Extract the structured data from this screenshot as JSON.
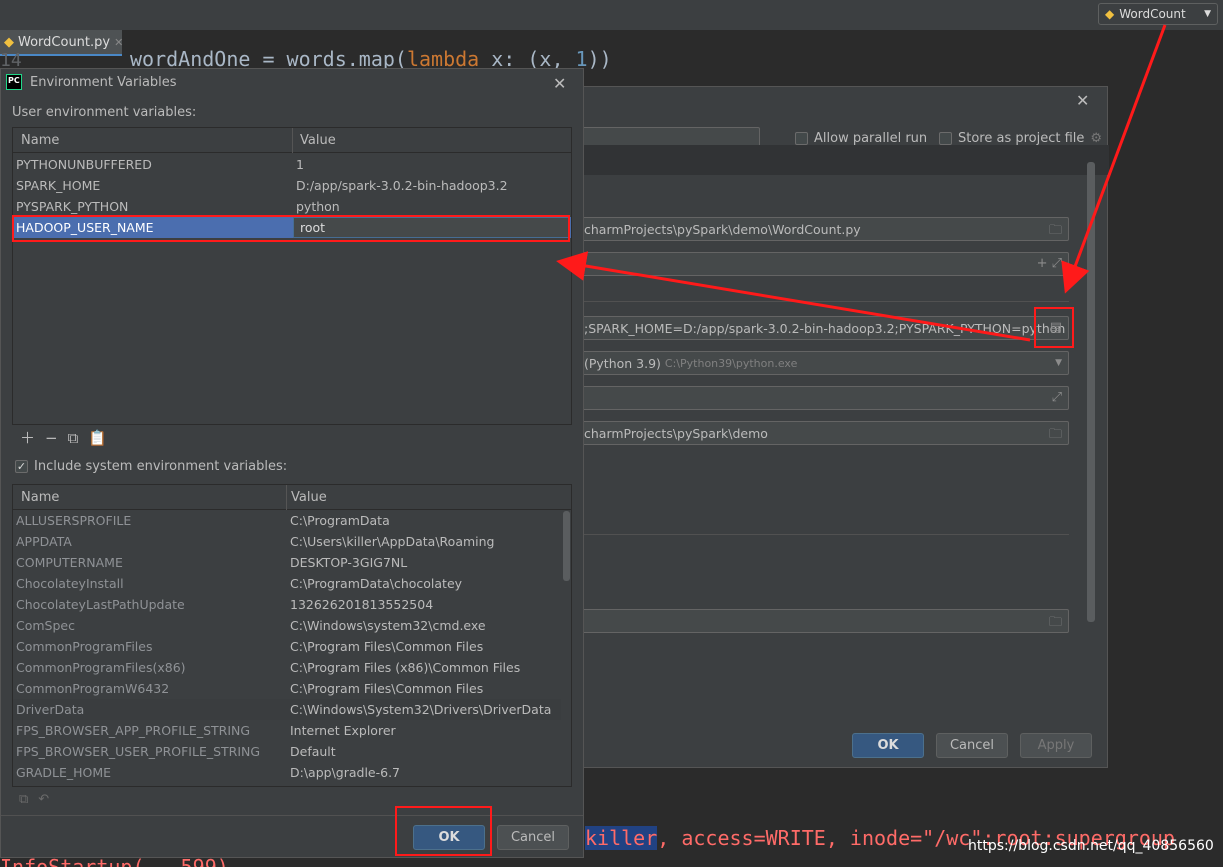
{
  "topbar": {
    "run_config_label": "WordCount"
  },
  "editor": {
    "tab_label": "WordCount.py",
    "gutter_number": "14",
    "code_prefix": "wordAndOne = words.map(",
    "code_keyword": "lambda",
    "code_mid": " x: (x, ",
    "code_num": "1",
    "code_suffix": "))",
    "console_hl": "killer",
    "console_rest": ", access=WRITE, inode=\"/wc\":root:supergroup",
    "console_line2": "InfoStartup(...599)",
    "watermark": "https://blog.csdn.net/qq_40856560"
  },
  "run_dialog": {
    "allow_parallel_label": "Allow parallel run",
    "store_project_label": "Store as project file",
    "script_path": "charmProjects\\pySpark\\demo\\WordCount.py",
    "env_vars": ";SPARK_HOME=D:/app/spark-3.0.2-bin-hadoop3.2;PYSPARK_PYTHON=python",
    "interpreter": "(Python 3.9)",
    "interpreter_path": "C:\\Python39\\python.exe",
    "working_dir": "charmProjects\\pySpark\\demo",
    "ok_label": "OK",
    "cancel_label": "Cancel",
    "apply_label": "Apply"
  },
  "env_dialog": {
    "title": "Environment Variables",
    "user_label": "User environment variables:",
    "col_name": "Name",
    "col_value": "Value",
    "user_rows": [
      {
        "name": "PYTHONUNBUFFERED",
        "value": "1"
      },
      {
        "name": "SPARK_HOME",
        "value": "D:/app/spark-3.0.2-bin-hadoop3.2"
      },
      {
        "name": "PYSPARK_PYTHON",
        "value": "python"
      },
      {
        "name": "HADOOP_USER_NAME",
        "value": "root"
      }
    ],
    "include_system_label": "Include system environment variables:",
    "system_rows": [
      {
        "name": "ALLUSERSPROFILE",
        "value": "C:\\ProgramData"
      },
      {
        "name": "APPDATA",
        "value": "C:\\Users\\killer\\AppData\\Roaming"
      },
      {
        "name": "COMPUTERNAME",
        "value": "DESKTOP-3GIG7NL"
      },
      {
        "name": "ChocolateyInstall",
        "value": "C:\\ProgramData\\chocolatey"
      },
      {
        "name": "ChocolateyLastPathUpdate",
        "value": "132626201813552504"
      },
      {
        "name": "ComSpec",
        "value": "C:\\Windows\\system32\\cmd.exe"
      },
      {
        "name": "CommonProgramFiles",
        "value": "C:\\Program Files\\Common Files"
      },
      {
        "name": "CommonProgramFiles(x86)",
        "value": "C:\\Program Files (x86)\\Common Files"
      },
      {
        "name": "CommonProgramW6432",
        "value": "C:\\Program Files\\Common Files"
      },
      {
        "name": "DriverData",
        "value": "C:\\Windows\\System32\\Drivers\\DriverData"
      },
      {
        "name": "FPS_BROWSER_APP_PROFILE_STRING",
        "value": "Internet Explorer"
      },
      {
        "name": "FPS_BROWSER_USER_PROFILE_STRING",
        "value": "Default"
      },
      {
        "name": "GRADLE_HOME",
        "value": "D:\\app\\gradle-6.7"
      }
    ],
    "ok_label": "OK",
    "cancel_label": "Cancel"
  },
  "colors": {
    "highlight_red": "#ff1a1a",
    "selection_blue": "#4b6eaf",
    "primary_button": "#365880"
  }
}
